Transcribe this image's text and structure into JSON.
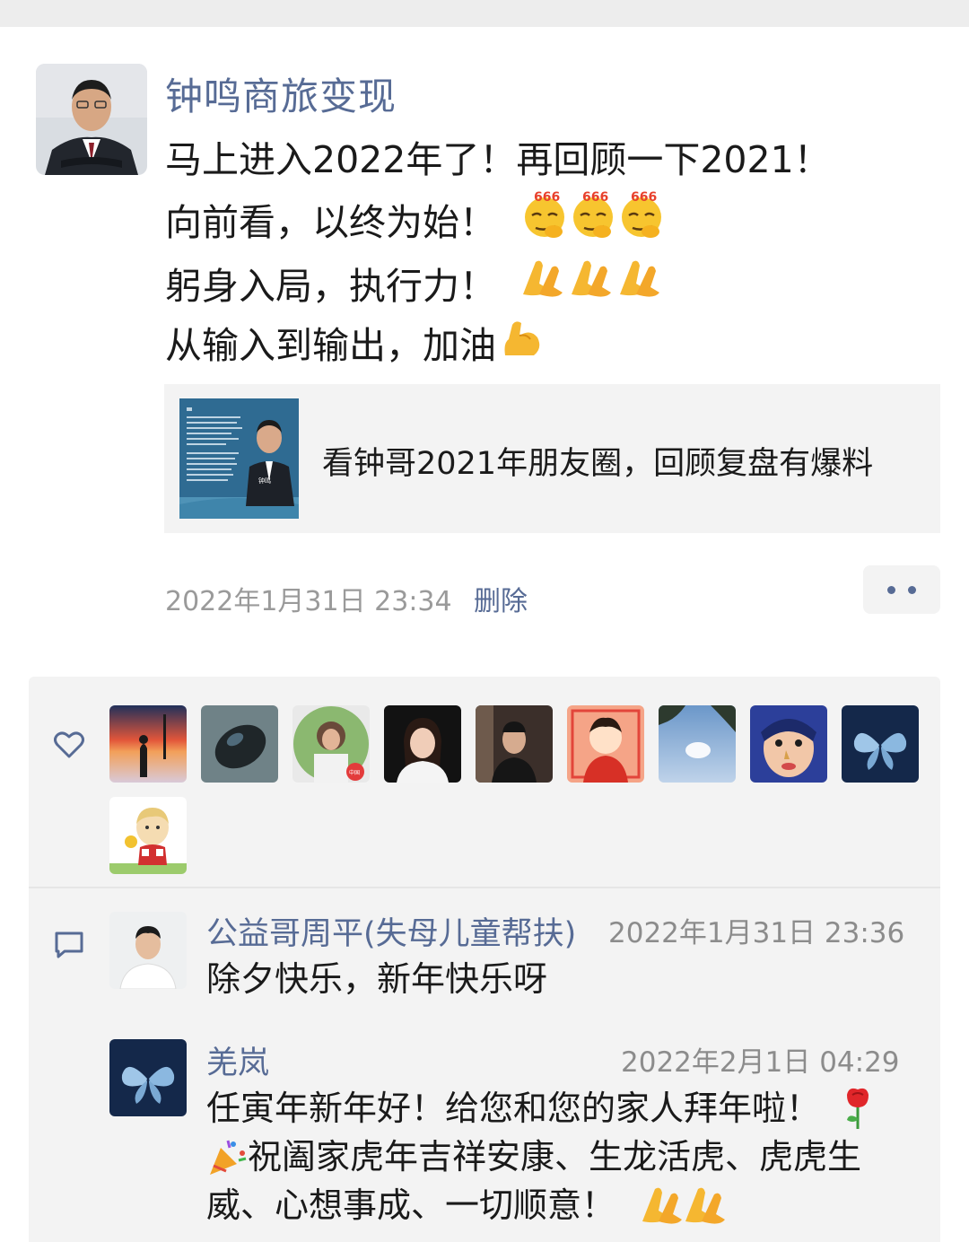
{
  "post": {
    "author": "钟鸣商旅变现",
    "lines": [
      "马上进入2022年了！再回顾一下2021！",
      "向前看，以终为始！",
      "躬身入局，执行力！",
      "从输入到输出，加油"
    ],
    "emoji_666": "666",
    "link_title": "看钟哥2021年朋友圈，回顾复盘有爆料",
    "link_thumb_caption": "钟鸣",
    "timestamp": "2022年1月31日 23:34",
    "delete_label": "删除"
  },
  "likes": {
    "icon": "heart-icon",
    "avatar_count": 10,
    "badge_text": "中国"
  },
  "comments": [
    {
      "name": "公益哥周平(失母儿童帮扶)",
      "time": "2022年1月31日 23:36",
      "text": "除夕快乐，新年快乐呀"
    },
    {
      "name": "羌岚",
      "time": "2022年2月1日 04:29",
      "text_line1": "任寅年新年好！给您和您的家人拜年啦！",
      "text_line2": "祝阖家虎年吉祥安康、生龙活虎、虎虎生",
      "text_line3": "威、心想事成、一切顺意！"
    }
  ],
  "colors": {
    "link_blue": "#576b95",
    "panel_gray": "#f3f3f3",
    "meta_gray": "#9a9a9a"
  }
}
